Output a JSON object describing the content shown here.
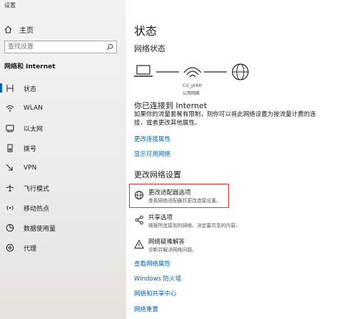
{
  "window": {
    "title": "设置"
  },
  "sidebar": {
    "home_label": "主页",
    "search_placeholder": "查找设置",
    "section_title": "网络和 Internet",
    "items": [
      {
        "label": "状态",
        "icon": "status-icon",
        "active": true
      },
      {
        "label": "WLAN",
        "icon": "wifi-icon"
      },
      {
        "label": "以太网",
        "icon": "ethernet-icon"
      },
      {
        "label": "拨号",
        "icon": "dialup-icon"
      },
      {
        "label": "VPN",
        "icon": "vpn-icon"
      },
      {
        "label": "飞行模式",
        "icon": "airplane-icon"
      },
      {
        "label": "移动热点",
        "icon": "hotspot-icon"
      },
      {
        "label": "数据使用量",
        "icon": "data-usage-icon"
      },
      {
        "label": "代理",
        "icon": "proxy-icon"
      }
    ]
  },
  "main": {
    "title": "状态",
    "network_status_heading": "网络状态",
    "network_name": "CU_yk6H",
    "network_type": "公用网络",
    "connected_heading": "你已连接到 Internet",
    "connected_desc": "如果你的流量套餐有限制，则你可以将此网络设置为按流量计费的连接，或者更改其他属性。",
    "link_change_props": "更改连接属性",
    "link_show_networks": "显示可用网络",
    "change_heading": "更改网络设置",
    "options": [
      {
        "title": "更改适配器选项",
        "desc": "查看网络适配器并更改连接设置。",
        "icon": "adapter-globe-icon"
      },
      {
        "title": "共享选项",
        "desc": "根据所连接到的网络，决定要共享的内容。",
        "icon": "sharing-icon"
      },
      {
        "title": "网络疑难解答",
        "desc": "诊断并解决网络问题。",
        "icon": "warning-icon"
      }
    ],
    "link_adapter_props": "查看网络属性",
    "link_firewall": "Windows 防火墙",
    "link_sharing_center": "网络和共享中心",
    "link_reset": "网络重置"
  },
  "colors": {
    "accent": "#0063b1",
    "highlight_box": "#e0312e"
  }
}
